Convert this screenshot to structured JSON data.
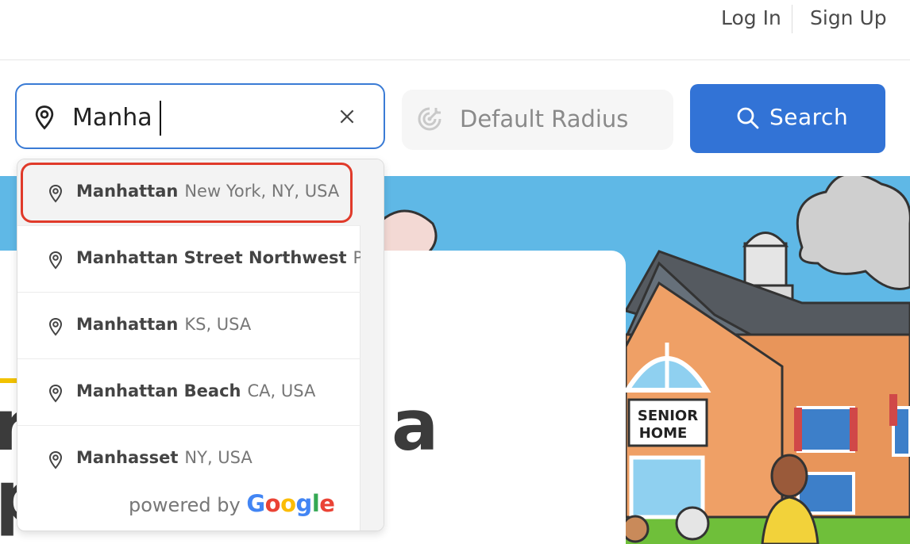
{
  "header": {
    "login_label": "Log In",
    "signup_label": "Sign Up"
  },
  "search": {
    "location_value": "Manha",
    "radius_label": "Default Radius",
    "button_label": "Search"
  },
  "dropdown": {
    "suggestions": [
      {
        "main": "Manhattan",
        "secondary": "New York, NY, USA"
      },
      {
        "main": "Manhattan Street Northwest",
        "secondary": "P"
      },
      {
        "main": "Manhattan",
        "secondary": "KS, USA"
      },
      {
        "main": "Manhattan Beach",
        "secondary": "CA, USA"
      },
      {
        "main": "Manhasset",
        "secondary": "NY, USA"
      }
    ],
    "powered_by": "powered by",
    "google": "Google"
  },
  "hero": {
    "sign_text": "SENIOR HOME"
  },
  "colors": {
    "primary": "#3273d6",
    "input_border": "#3a7bd5",
    "highlight": "#e03a2a",
    "sky": "#5fb8e6",
    "accent": "#f2c200"
  }
}
